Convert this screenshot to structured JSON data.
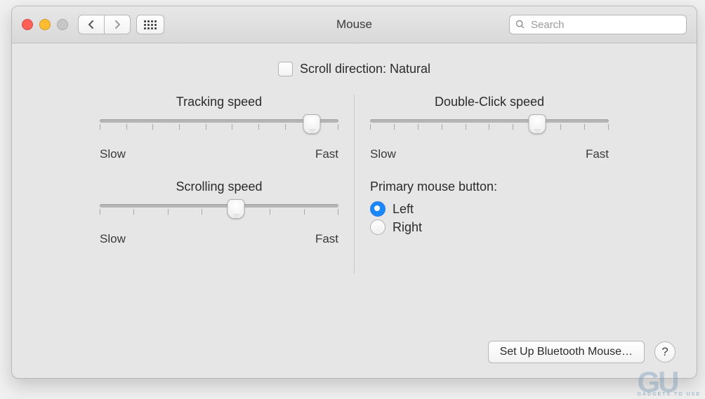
{
  "window": {
    "title": "Mouse"
  },
  "search": {
    "placeholder": "Search"
  },
  "scrollDirection": {
    "label": "Scroll direction: Natural",
    "checked": false
  },
  "sliders": {
    "tracking": {
      "title": "Tracking speed",
      "low": "Slow",
      "high": "Fast",
      "ticks": 10,
      "valueIndex": 8
    },
    "doubleClick": {
      "title": "Double-Click speed",
      "low": "Slow",
      "high": "Fast",
      "ticks": 11,
      "valueIndex": 7
    },
    "scrolling": {
      "title": "Scrolling speed",
      "low": "Slow",
      "high": "Fast",
      "ticks": 8,
      "valueIndex": 4
    }
  },
  "primaryButton": {
    "title": "Primary mouse button:",
    "options": {
      "left": "Left",
      "right": "Right"
    },
    "selected": "left"
  },
  "buttons": {
    "bluetooth": "Set Up Bluetooth Mouse…"
  },
  "watermark": {
    "logo": "GU",
    "tagline": "GADGETS TO USE"
  }
}
